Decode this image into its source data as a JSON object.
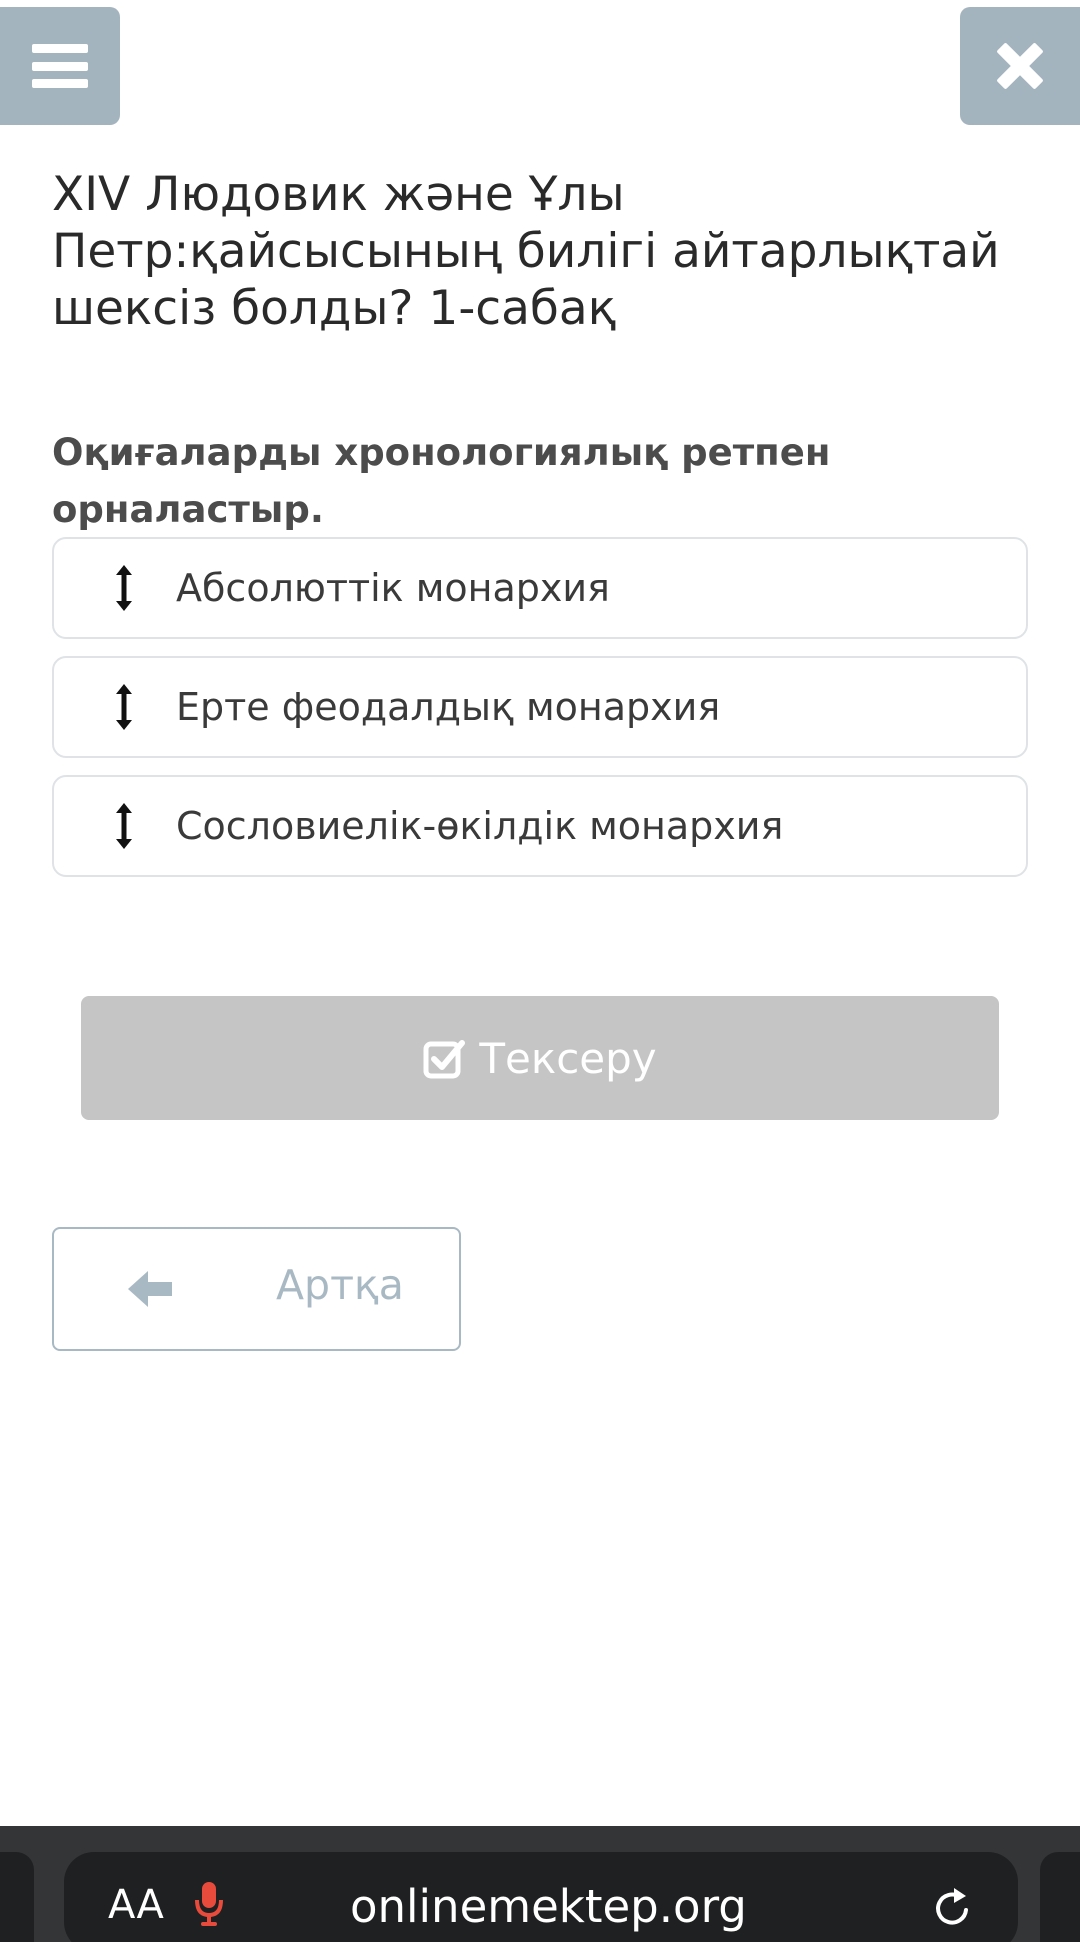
{
  "header": {
    "menu_icon": "hamburger-menu-icon",
    "close_icon": "close-icon",
    "button_color": "#a4b4bf"
  },
  "lesson": {
    "title": "XIV Людовик және Ұлы Петр:қайсысының билігі айтарлықтай шексіз болды? 1-сабақ",
    "instruction": "Оқиғаларды хронологиялық ретпен орналастыр."
  },
  "sortable_items": [
    {
      "label": "Абсолюттік монархия",
      "icon": "drag-vertical-arrow-icon"
    },
    {
      "label": "Ерте феодалдық монархия",
      "icon": "drag-vertical-arrow-icon"
    },
    {
      "label": "Сословиелік-өкілдік монархия",
      "icon": "drag-vertical-arrow-icon"
    }
  ],
  "actions": {
    "check_label": "Тексеру",
    "check_icon": "checkbox-check-icon",
    "back_label": "Артқа",
    "back_icon": "arrow-left-icon"
  },
  "browser": {
    "text_size_label": "AA",
    "mic_icon": "microphone-icon",
    "url": "onlinemektep.org",
    "reload_icon": "reload-icon"
  },
  "colors": {
    "check_button_bg": "#c5c5c5",
    "back_button_accent": "#a9b9c4",
    "browser_bar_bg": "#1f2021",
    "mic_red": "#e84b3c"
  }
}
